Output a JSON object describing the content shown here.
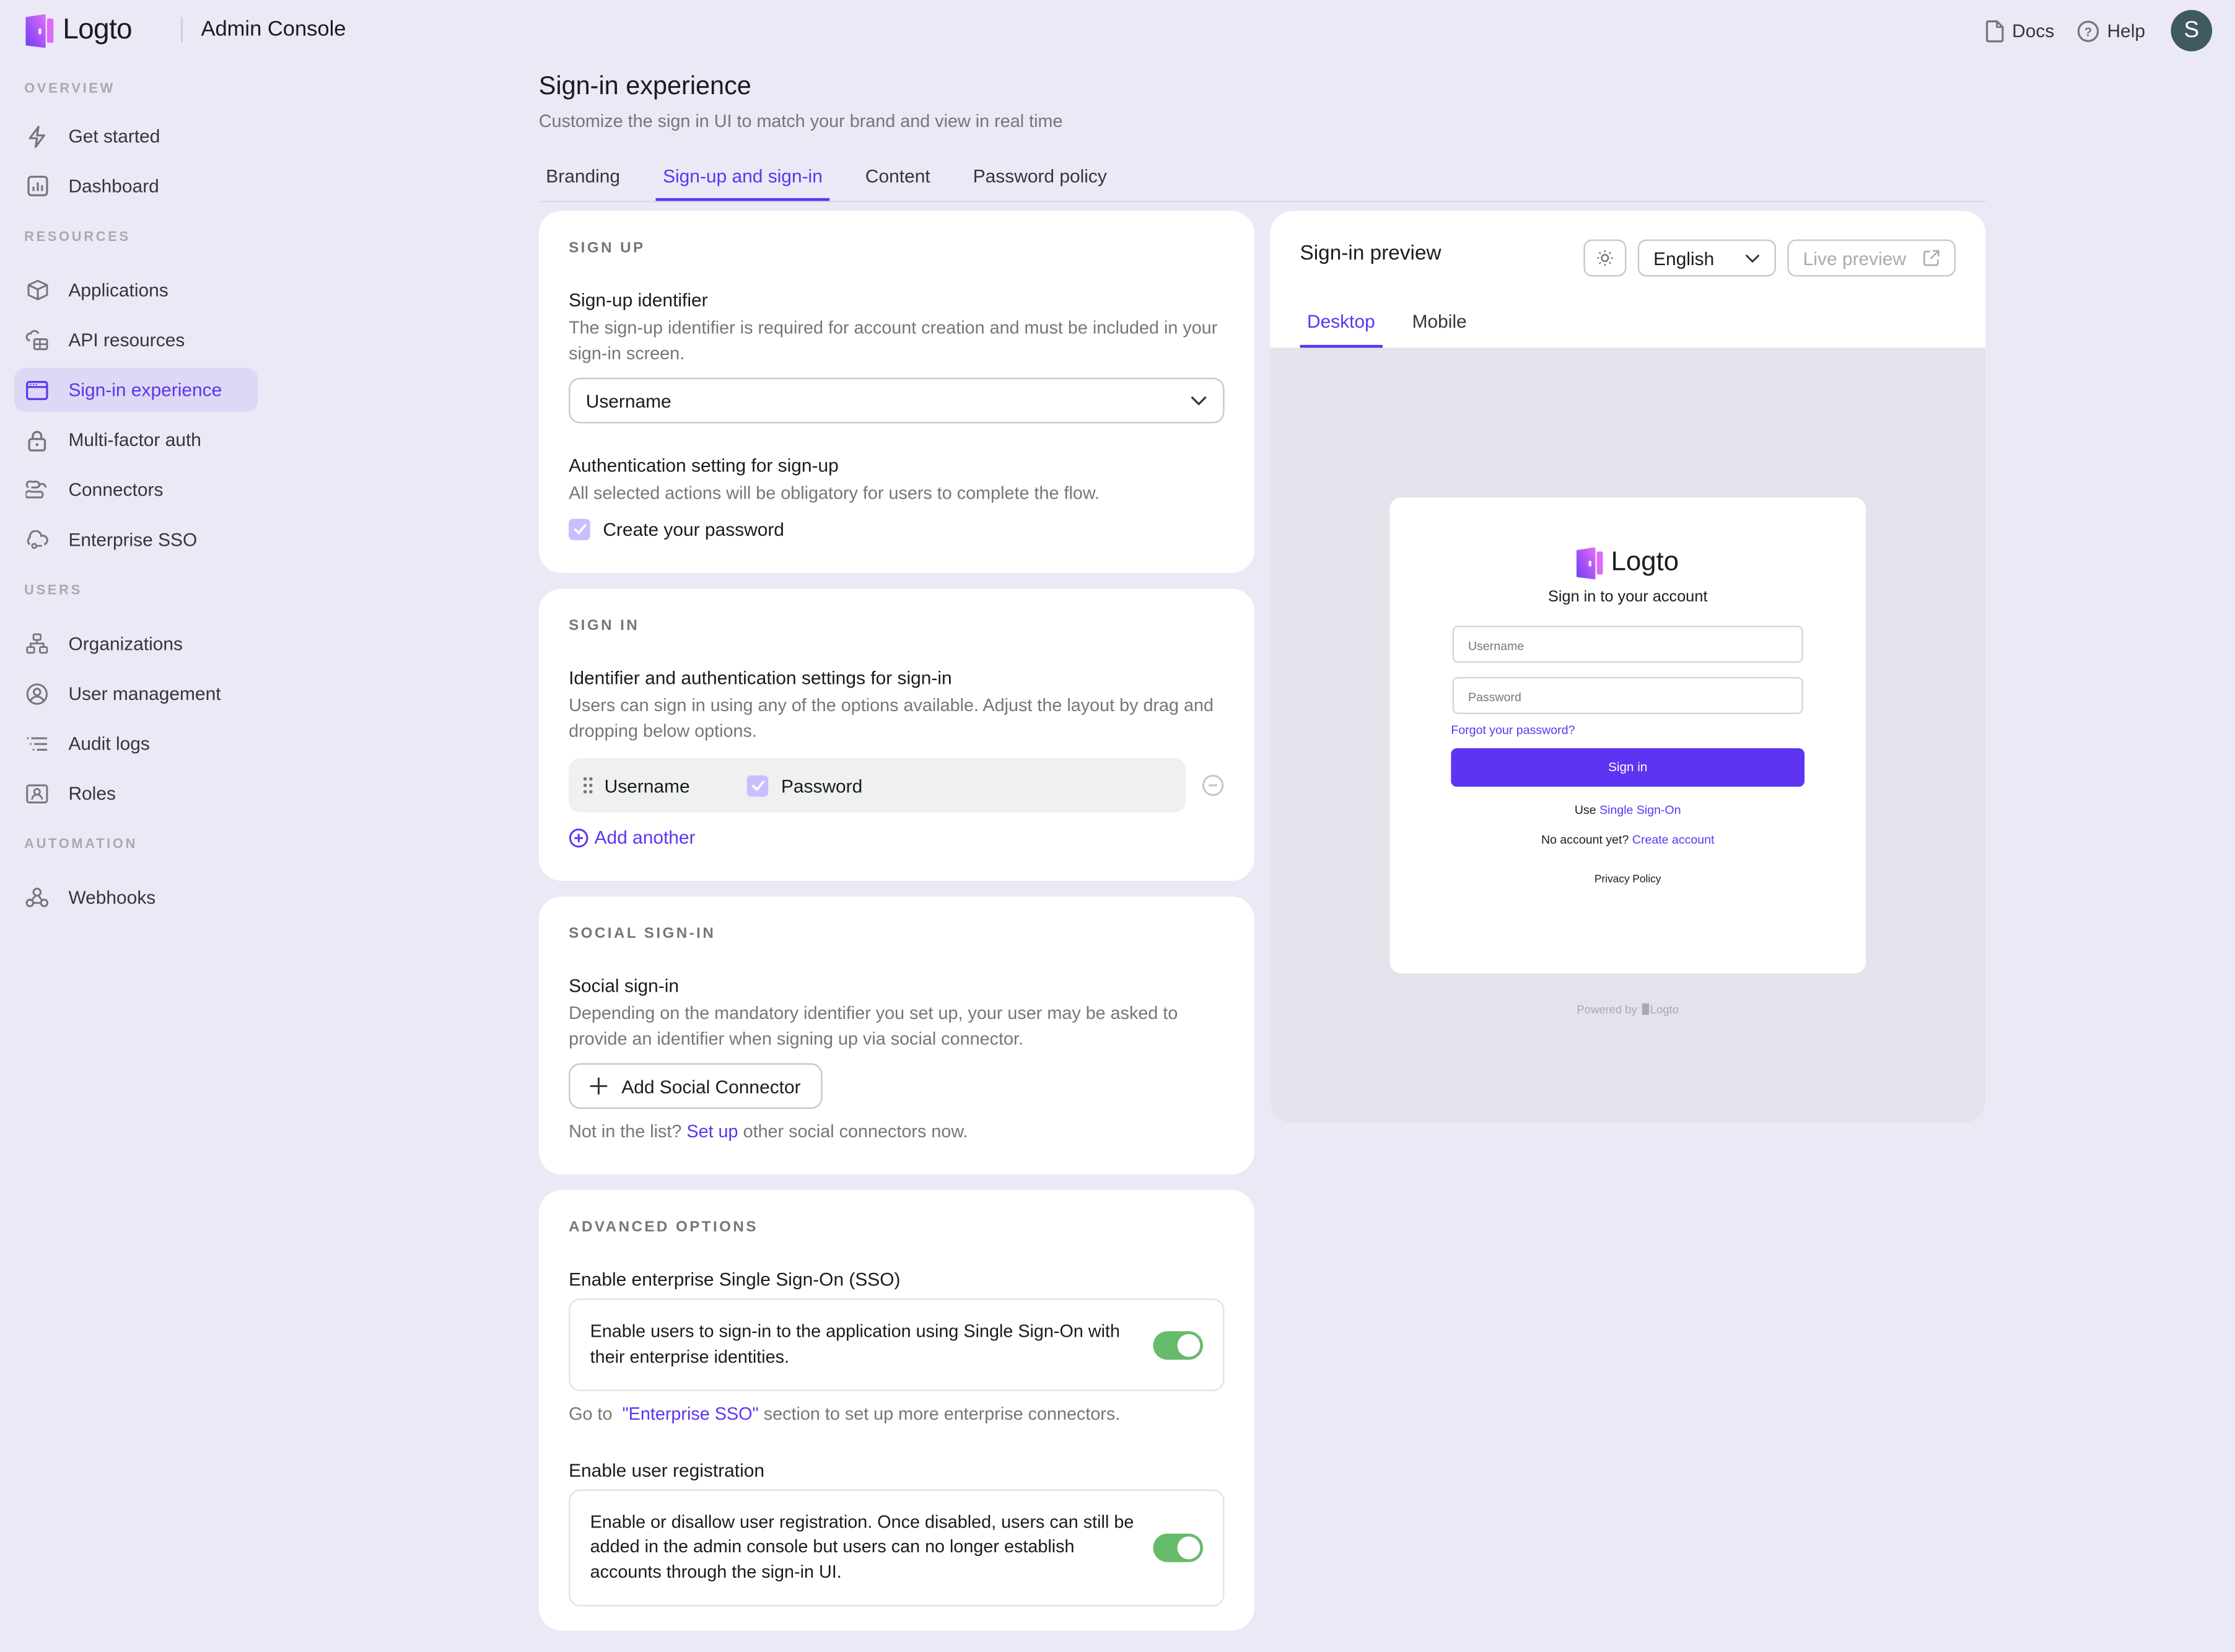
{
  "header": {
    "brand": "Logto",
    "app_title": "Admin Console",
    "docs_label": "Docs",
    "help_label": "Help",
    "avatar_initial": "S"
  },
  "sidebar": {
    "sections": [
      {
        "label": "OVERVIEW",
        "items": [
          {
            "label": "Get started",
            "icon": "lightning-icon"
          },
          {
            "label": "Dashboard",
            "icon": "bar-chart-icon"
          }
        ]
      },
      {
        "label": "RESOURCES",
        "items": [
          {
            "label": "Applications",
            "icon": "box-icon"
          },
          {
            "label": "API resources",
            "icon": "cloud-database-icon"
          },
          {
            "label": "Sign-in experience",
            "icon": "browser-window-icon",
            "active": true
          },
          {
            "label": "Multi-factor auth",
            "icon": "lock-icon"
          },
          {
            "label": "Connectors",
            "icon": "connectors-icon"
          },
          {
            "label": "Enterprise SSO",
            "icon": "cloud-key-icon"
          }
        ]
      },
      {
        "label": "USERS",
        "items": [
          {
            "label": "Organizations",
            "icon": "org-chart-icon"
          },
          {
            "label": "User management",
            "icon": "user-circle-icon"
          },
          {
            "label": "Audit logs",
            "icon": "list-icon"
          },
          {
            "label": "Roles",
            "icon": "id-badge-icon"
          }
        ]
      },
      {
        "label": "AUTOMATION",
        "items": [
          {
            "label": "Webhooks",
            "icon": "webhook-icon"
          }
        ]
      }
    ]
  },
  "page": {
    "title": "Sign-in experience",
    "subtitle": "Customize the sign in UI to match your brand and view in real time",
    "tabs": [
      {
        "label": "Branding"
      },
      {
        "label": "Sign-up and sign-in",
        "active": true
      },
      {
        "label": "Content"
      },
      {
        "label": "Password policy"
      }
    ]
  },
  "sign_up": {
    "heading": "SIGN UP",
    "identifier_title": "Sign-up identifier",
    "identifier_desc": "The sign-up identifier is required for account creation and must be included in your sign-in screen.",
    "identifier_value": "Username",
    "auth_title": "Authentication setting for sign-up",
    "auth_desc": "All selected actions will be obligatory for users to complete the flow.",
    "create_password_label": "Create your password",
    "create_password_checked": true
  },
  "sign_in": {
    "heading": "SIGN IN",
    "title": "Identifier and authentication settings for sign-in",
    "desc": "Users can sign in using any of the options available. Adjust the layout by drag and dropping below options.",
    "methods": [
      {
        "identifier": "Username",
        "password_label": "Password",
        "password_checked": true
      }
    ],
    "add_another_label": "Add another"
  },
  "social": {
    "heading": "SOCIAL SIGN-IN",
    "title": "Social sign-in",
    "desc": "Depending on the mandatory identifier you set up, your user may be asked to provide an identifier when signing up via social connector.",
    "add_button": "Add Social Connector",
    "note_prefix": "Not in the list?",
    "note_link": "Set up",
    "note_suffix": "other social connectors now."
  },
  "advanced": {
    "heading": "ADVANCED OPTIONS",
    "sso_title": "Enable enterprise Single Sign-On (SSO)",
    "sso_desc": "Enable users to sign-in to the application using Single Sign-On with their enterprise identities.",
    "sso_enabled": true,
    "sso_note_prefix": "Go to",
    "sso_note_link": "\"Enterprise SSO\"",
    "sso_note_suffix": "section to set up more enterprise connectors.",
    "reg_title": "Enable user registration",
    "reg_desc": "Enable or disallow user registration. Once disabled, users can still be added in the admin console but users can no longer establish accounts through the sign-in UI.",
    "reg_enabled": true
  },
  "preview": {
    "title": "Sign-in preview",
    "language": "English",
    "live_preview_label": "Live preview",
    "tabs": [
      {
        "label": "Desktop",
        "active": true
      },
      {
        "label": "Mobile"
      }
    ],
    "form": {
      "brand": "Logto",
      "title": "Sign in to your account",
      "username_placeholder": "Username",
      "password_placeholder": "Password",
      "forgot_label": "Forgot your password?",
      "sign_in_label": "Sign in",
      "sso_prefix": "Use",
      "sso_link": "Single Sign-On",
      "no_account_prefix": "No account yet?",
      "create_account_link": "Create account",
      "privacy_label": "Privacy Policy",
      "powered_by": "Powered by",
      "powered_brand": "Logto"
    }
  },
  "colors": {
    "accent": "#5d34f2",
    "background": "#ebe9f5",
    "toggle_on": "#66bb6a",
    "avatar": "#3f5a60"
  }
}
